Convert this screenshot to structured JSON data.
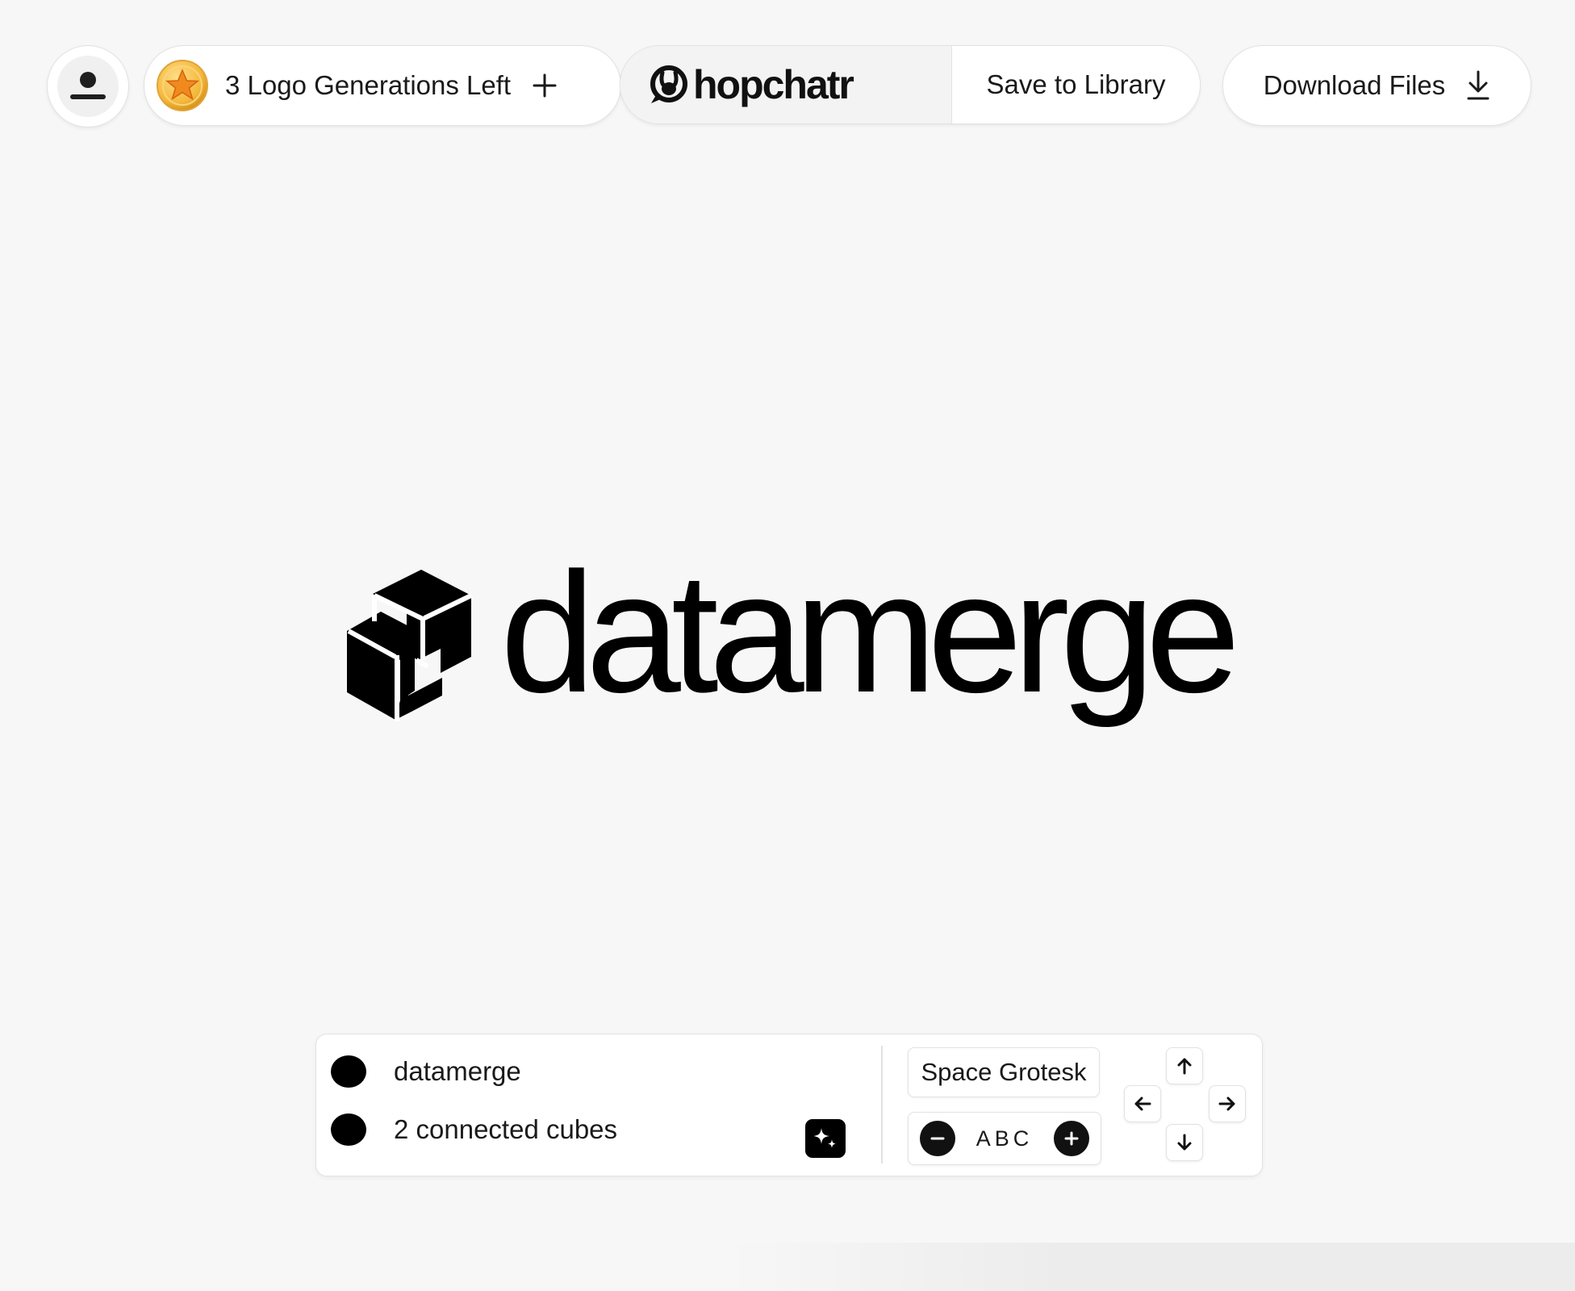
{
  "header": {
    "credits_label": "3 Logo Generations Left",
    "brand_name": "hopchatr",
    "save_label": "Save to Library",
    "download_label": "Download Files"
  },
  "canvas": {
    "logo_text": "datamerge",
    "logo_icon": "two-connected-cubes-icon"
  },
  "editor": {
    "name_value": "datamerge",
    "icon_prompt_value": "2 connected cubes",
    "font_name": "Space Grotesk",
    "spacing_label": "ABC",
    "text_color": "#000000",
    "icon_color": "#000000"
  },
  "icons": {
    "avatar": "user-icon",
    "coin": "star-coin-icon",
    "add": "plus-icon",
    "download": "download-icon",
    "magic": "sparkles-icon",
    "decrease": "minus-icon",
    "increase": "plus-icon",
    "up": "arrow-up-icon",
    "down": "arrow-down-icon",
    "left": "arrow-left-icon",
    "right": "arrow-right-icon"
  }
}
